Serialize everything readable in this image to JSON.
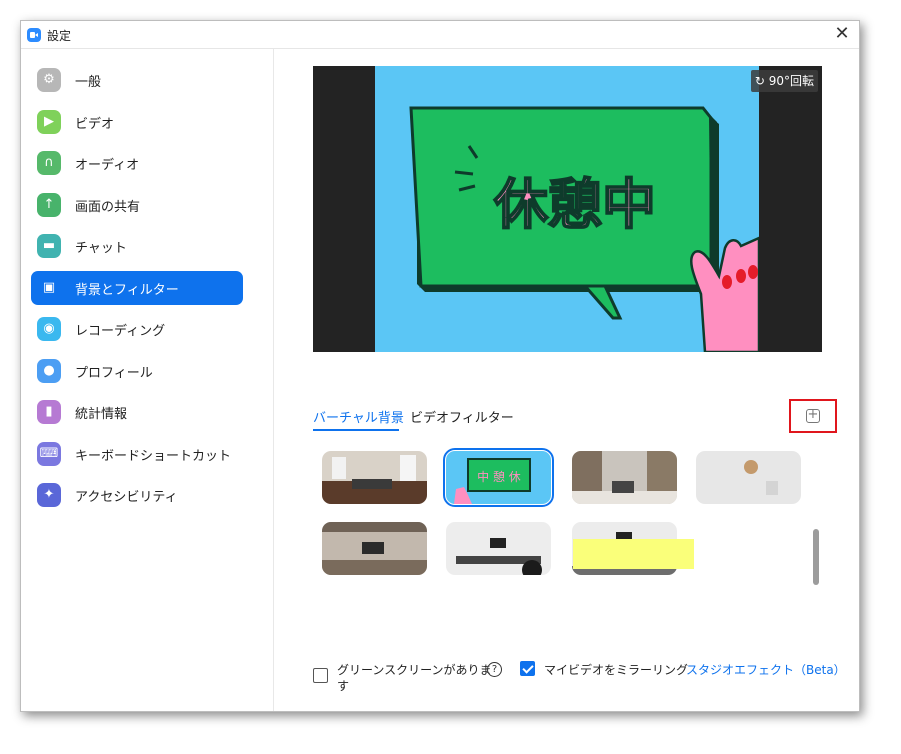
{
  "window": {
    "title": "設定",
    "close_label": "✕"
  },
  "sidebar": {
    "items": [
      {
        "label": "一般",
        "icon": "gear-icon",
        "glyph": "⚙",
        "color": "#b7b7b7"
      },
      {
        "label": "ビデオ",
        "icon": "video-camera-icon",
        "glyph": "▶",
        "color": "#7fd15a"
      },
      {
        "label": "オーディオ",
        "icon": "headphones-icon",
        "glyph": "∩",
        "color": "#56b96a"
      },
      {
        "label": "画面の共有",
        "icon": "share-screen-icon",
        "glyph": "↑",
        "color": "#48b36b"
      },
      {
        "label": "チャット",
        "icon": "chat-bubble-icon",
        "glyph": "▬",
        "color": "#40b3b0"
      },
      {
        "label": "背景とフィルター",
        "icon": "background-icon",
        "glyph": "▣",
        "color": "#0e72ed",
        "active": true
      },
      {
        "label": "レコーディング",
        "icon": "recording-icon",
        "glyph": "◉",
        "color": "#3ab8ef"
      },
      {
        "label": "プロフィール",
        "icon": "profile-icon",
        "glyph": "●",
        "color": "#4c9ef3"
      },
      {
        "label": "統計情報",
        "icon": "statistics-icon",
        "glyph": "▮",
        "color": "#b67ad3"
      },
      {
        "label": "キーボードショートカット",
        "icon": "keyboard-icon",
        "glyph": "⌨",
        "color": "#7b78e0"
      },
      {
        "label": "アクセシビリティ",
        "icon": "accessibility-icon",
        "glyph": "✦",
        "color": "#5a67d8"
      }
    ]
  },
  "preview": {
    "sign_text": "休憩中",
    "rotate_label": "90°回転"
  },
  "tabs": [
    {
      "label": "バーチャル背景",
      "active": true
    },
    {
      "label": "ビデオフィルター",
      "active": false
    }
  ],
  "add_button_glyph": "+",
  "backgrounds": [
    {
      "name": "lounge"
    },
    {
      "name": "break-sign",
      "label": "中 憩 休",
      "selected": true
    },
    {
      "name": "library"
    },
    {
      "name": "clock-wall"
    },
    {
      "name": "tv-room"
    },
    {
      "name": "meeting-room"
    },
    {
      "name": "office"
    }
  ],
  "footer": {
    "green_screen_label": "グリーンスクリーンがありま",
    "green_screen_label_cont": "す",
    "green_screen_checked": false,
    "help_glyph": "?",
    "mirror_label": "マイビデオをミラーリング",
    "mirror_checked": true,
    "studio_effects_link": "スタジオエフェクト（Beta）"
  }
}
